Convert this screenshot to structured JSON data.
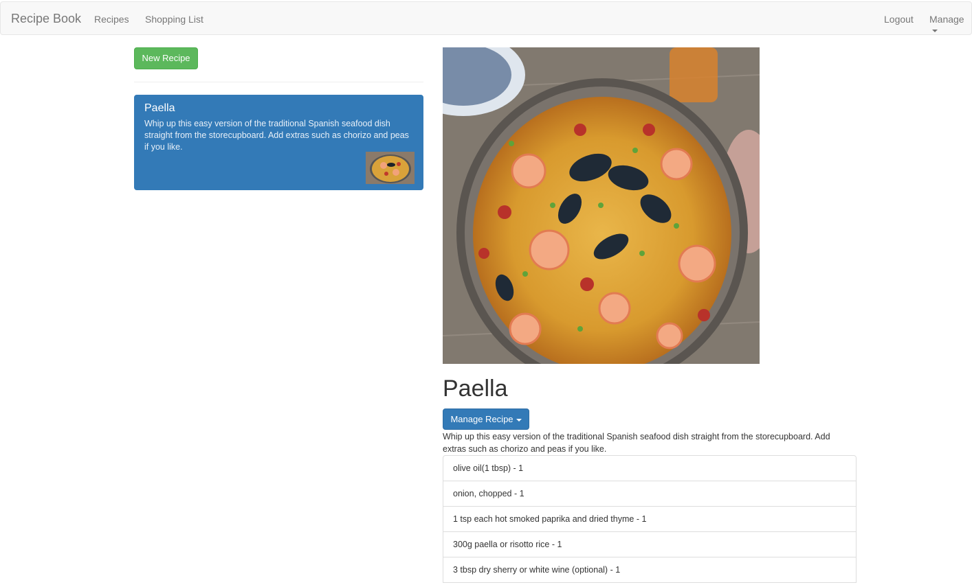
{
  "navbar": {
    "brand": "Recipe Book",
    "links": [
      "Recipes",
      "Shopping List"
    ],
    "logout": "Logout",
    "manage": "Manage"
  },
  "sidebar": {
    "new_recipe_button": "New Recipe",
    "recipes": [
      {
        "title": "Paella",
        "description": "Whip up this easy version of the traditional Spanish seafood dish straight from the storecupboard. Add extras such as chorizo and peas if you like."
      }
    ]
  },
  "detail": {
    "title": "Paella",
    "manage_button": "Manage Recipe",
    "description": "Whip up this easy version of the traditional Spanish seafood dish straight from the storecupboard. Add extras such as chorizo and peas if you like.",
    "ingredients": [
      "olive oil(1 tbsp) - 1",
      "onion, chopped - 1",
      "1 tsp each hot smoked paprika and dried thyme - 1",
      "300g paella or risotto rice - 1",
      "3 tbsp dry sherry or white wine (optional) - 1"
    ]
  },
  "colors": {
    "success": "#5cb85c",
    "primary": "#337ab7",
    "navbar_bg": "#f8f8f8"
  }
}
